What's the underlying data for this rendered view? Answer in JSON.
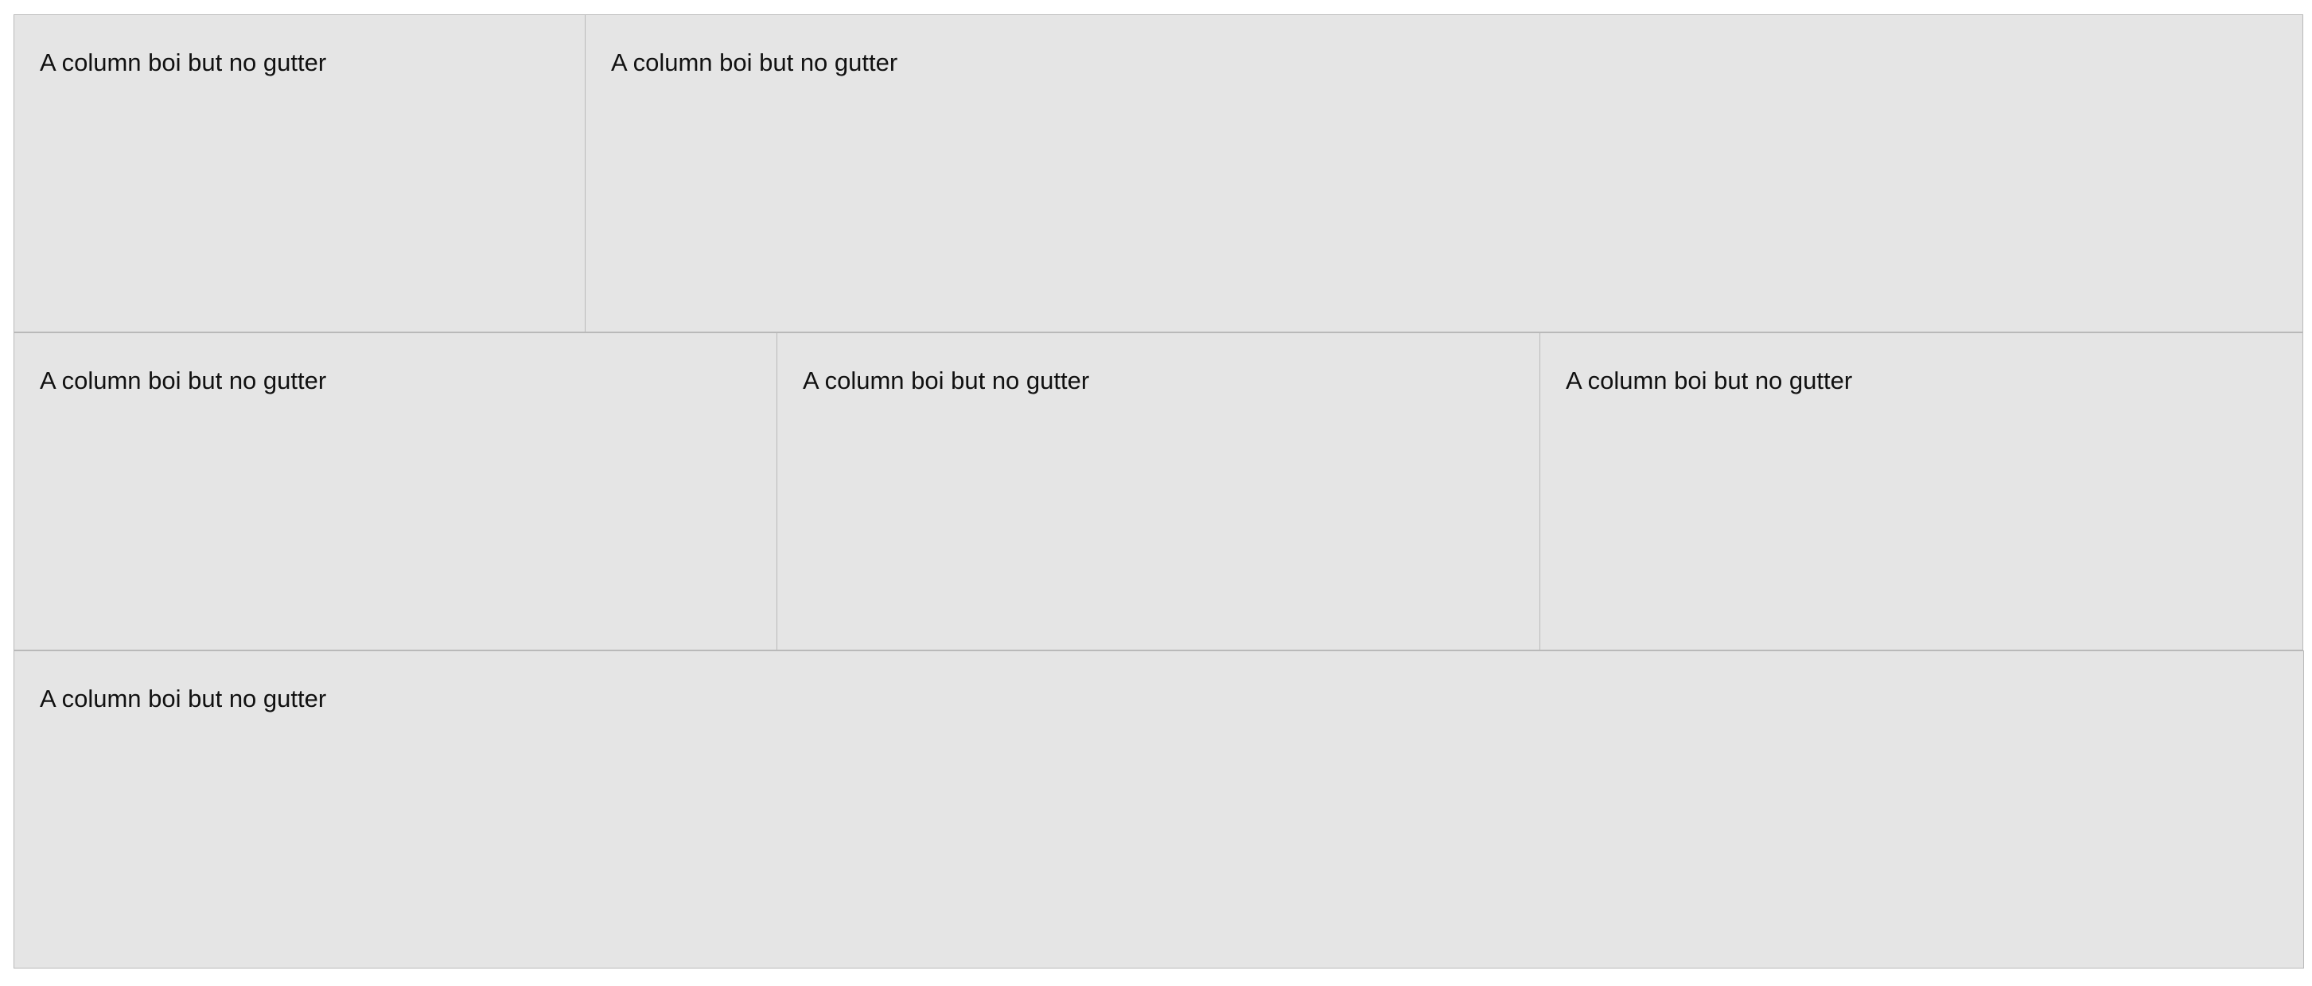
{
  "rows": [
    {
      "columns": [
        {
          "text": "A column boi but no gutter"
        },
        {
          "text": "A column boi but no gutter"
        }
      ]
    },
    {
      "columns": [
        {
          "text": "A column boi but no gutter"
        },
        {
          "text": "A column boi but no gutter"
        },
        {
          "text": "A column boi but no gutter"
        }
      ]
    },
    {
      "columns": [
        {
          "text": "A column boi but no gutter"
        }
      ]
    }
  ],
  "colors": {
    "column_background": "#e5e5e5",
    "column_border": "#b9b9b9",
    "page_background": "#ffffff",
    "text": "#111111"
  }
}
